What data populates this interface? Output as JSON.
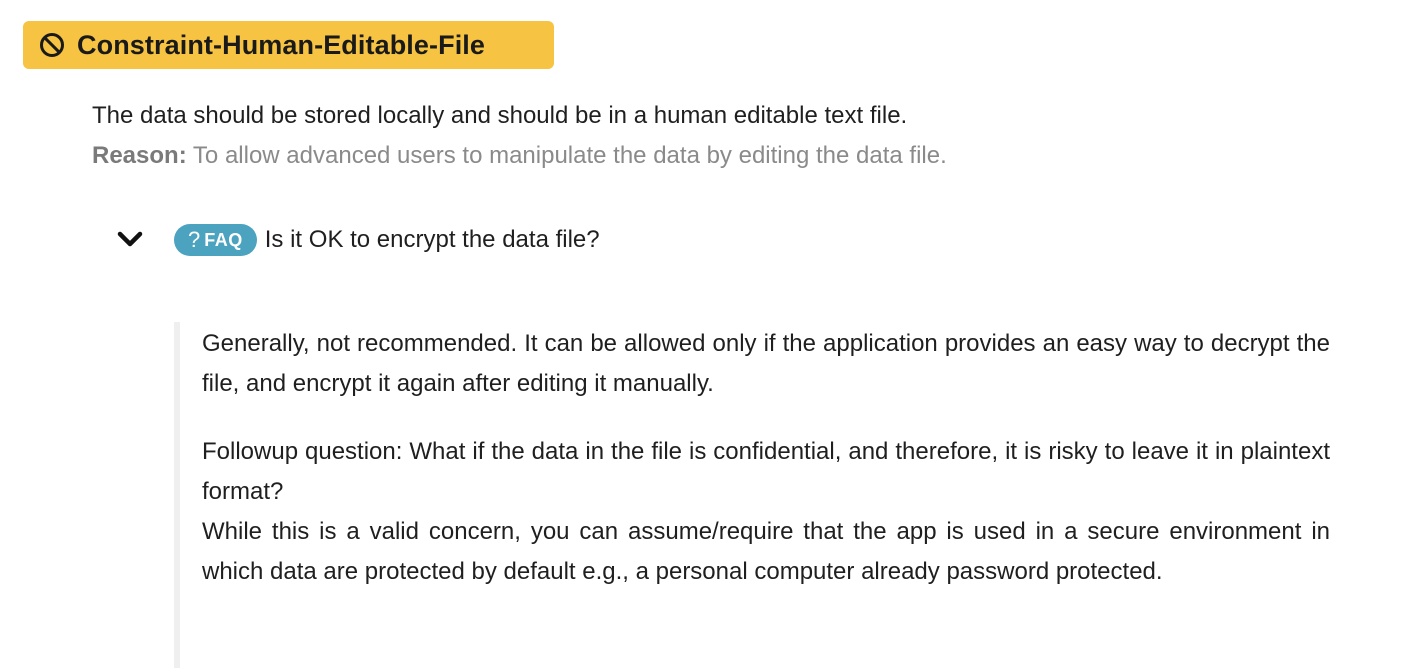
{
  "constraint": {
    "title": "Constraint-Human-Editable-File",
    "icon": "ban-icon",
    "color": "#f6c342"
  },
  "statement": "The data should be stored locally and should be in a human editable text file.",
  "reason": {
    "label": "Reason:",
    "text": " To allow advanced users to manipulate the data by editing the data file."
  },
  "faq": {
    "toggle_icon": "chevron-down-icon",
    "badge_icon": "?",
    "badge_label": "FAQ",
    "badge_color": "#4ba3c0",
    "question": "Is it OK to encrypt the data file?",
    "answer": {
      "paragraph_1": "Generally, not recommended. It can be allowed only if the application provides an easy way to decrypt the file, and encrypt it again after editing it manually.",
      "followup_question": "Followup question: What if the data in the file is confidential, and therefore, it is risky to leave it in plaintext format?",
      "followup_answer": "While this is a valid concern, you can assume/require that the app is used in a secure environment in which data are protected by default e.g., a personal computer already password protected."
    }
  }
}
